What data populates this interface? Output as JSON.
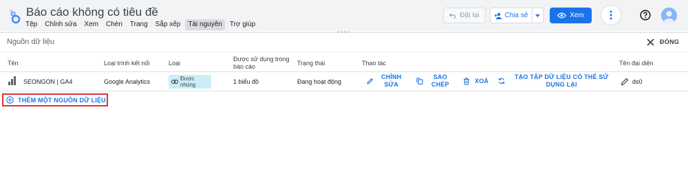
{
  "app": {
    "doc_title": "Báo cáo không có tiêu đề",
    "menu": [
      "Tệp",
      "Chỉnh sửa",
      "Xem",
      "Chèn",
      "Trang",
      "Sắp xếp",
      "Tài nguyên",
      "Trợ giúp"
    ],
    "active_menu": "Tài nguyên",
    "toolbar": {
      "undo_label": "Đặt lại",
      "share_label": "Chia sẻ",
      "view_label": "Xem"
    },
    "colors": {
      "accent": "#1a73e8",
      "header_bg": "#f1f3f4",
      "badge_bg": "#cbeef6",
      "highlight_border": "#e03131"
    }
  },
  "panel": {
    "title": "Nguồn dữ liệu",
    "close_label": "ĐÓNG",
    "columns": {
      "name": "Tên",
      "connector": "Loại trình kết nối",
      "type": "Loại",
      "used_in_l1": "Được sử dụng trong",
      "used_in_l2": "báo cáo",
      "status": "Trạng thái",
      "actions": "Thao tác",
      "alias": "Tên đại diện"
    },
    "rows": [
      {
        "name": "SEONGON | GA4",
        "connector": "Google Analytics",
        "type_l1": "Được",
        "type_l2": "nhúng",
        "used_in": "1 biểu đồ",
        "status": "Đang hoạt động",
        "actions": {
          "edit_l1": "CHỈNH",
          "edit_l2": "SỬA",
          "copy_l1": "SAO",
          "copy_l2": "CHÉP",
          "delete": "XOÁ",
          "reusable_l1": "TẠO TẬP DỮ LIỆU CÓ THỂ SỬ",
          "reusable_l2": "DỤNG LẠI"
        },
        "alias": "ds0"
      }
    ],
    "add_source_label": "THÊM MỘT NGUỒN DỮ LIỆU"
  }
}
